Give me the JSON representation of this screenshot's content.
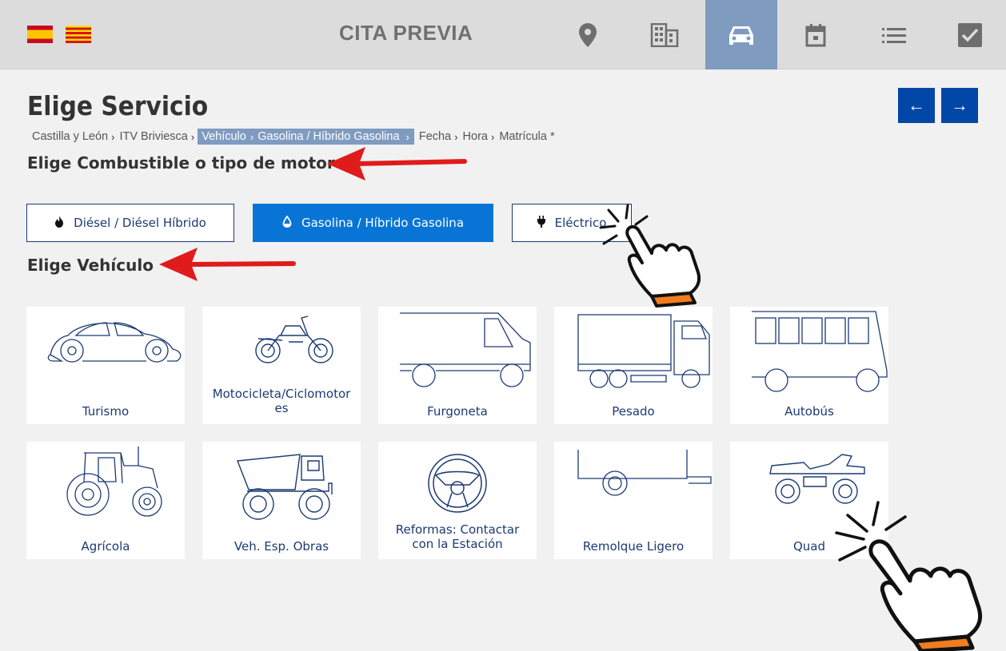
{
  "topbar": {
    "title": "CITA PREVIA",
    "languages": [
      "es-flag-icon",
      "ca-flag-icon"
    ],
    "icons": [
      "location-pin-icon",
      "building-icon",
      "car-icon",
      "calendar-icon",
      "list-icon",
      "checkbox-icon"
    ],
    "active_icon": "car-icon",
    "active_color": "#7f9bc0"
  },
  "header": {
    "title": "Elige Servicio",
    "prev_label": "←",
    "next_label": "→"
  },
  "breadcrumb": {
    "items": [
      "Castilla y León",
      "ITV Briviesca",
      "Vehículo",
      "Gasolina / Híbrido Gasolina",
      "Fecha",
      "Hora",
      "Matrícula *"
    ]
  },
  "fuel": {
    "title": "Elige Combustible o tipo de motor",
    "options": [
      {
        "label": "Diésel / Diésel Híbrido",
        "icon": "flame-icon"
      },
      {
        "label": "Gasolina / Híbrido Gasolina",
        "icon": "drop-icon",
        "selected": true
      },
      {
        "label": "Eléctrico",
        "icon": "plug-icon"
      }
    ]
  },
  "vehicles": {
    "title": "Elige Vehículo",
    "items": [
      {
        "label": "Turismo",
        "icon": "car-outline-icon"
      },
      {
        "label": "Motocicleta/Ciclomotor",
        "label2": "es",
        "icon": "motorcycle-icon"
      },
      {
        "label": "Furgoneta",
        "icon": "van-icon"
      },
      {
        "label": "Pesado",
        "icon": "truck-icon"
      },
      {
        "label": "Autobús",
        "icon": "bus-icon"
      },
      {
        "label": "Agrícola",
        "icon": "tractor-icon"
      },
      {
        "label": "Veh. Esp. Obras",
        "icon": "dump-truck-icon"
      },
      {
        "label": "Reformas: Contactar",
        "label2": "con la Estación",
        "icon": "steering-wheel-icon"
      },
      {
        "label": "Remolque Ligero",
        "icon": "trailer-icon"
      },
      {
        "label": "Quad",
        "icon": "quad-icon"
      }
    ]
  },
  "colors": {
    "primary": "#0047a8",
    "selected": "#0875d6",
    "text_blue": "#1c3a73",
    "annotation_red": "#e01b1b"
  }
}
